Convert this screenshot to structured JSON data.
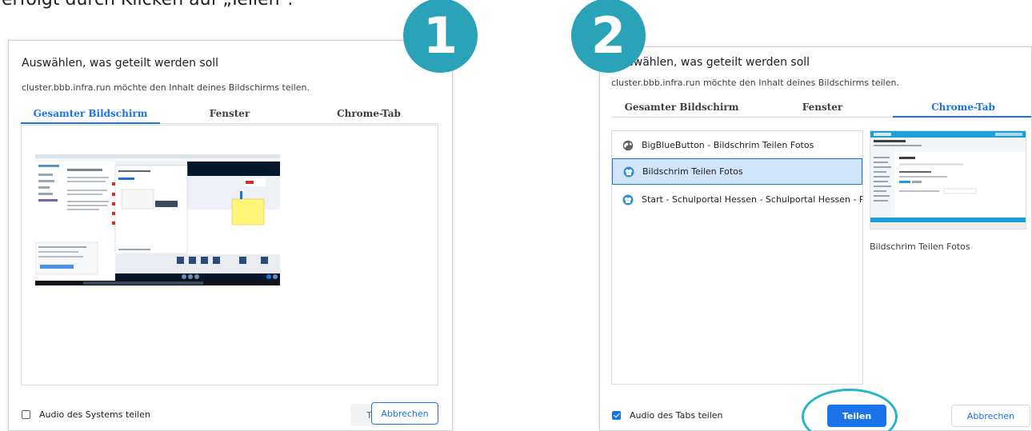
{
  "intro_text": "erfolgt durch Klicken auf „Teilen“.",
  "step1": {
    "badge": "1",
    "title": "Auswählen, was geteilt werden soll",
    "subtitle": "cluster.bbb.infra.run möchte den Inhalt deines Bildschirms teilen.",
    "tabs": [
      "Gesamter Bildschirm",
      "Fenster",
      "Chrome-Tab"
    ],
    "active_tab": 0,
    "audio_label": "Audio des Systems teilen",
    "audio_checked": false,
    "share_button": "Teilen",
    "cancel_button": "Abbrechen"
  },
  "step2": {
    "badge": "2",
    "title": "Auswählen, was geteilt werden soll",
    "subtitle": "cluster.bbb.infra.run möchte den Inhalt deines Bildschirms teilen.",
    "tabs": [
      "Gesamter Bildschirm",
      "Fenster",
      "Chrome-Tab"
    ],
    "active_tab": 2,
    "list": [
      {
        "label": "BigBlueButton - Bildschrim Teilen Fotos",
        "icon": "globe-icon",
        "selected": false
      },
      {
        "label": "Bildschrim Teilen Fotos",
        "icon": "bbb-favicon-icon",
        "selected": true
      },
      {
        "label": "Start - Schulportal Hessen - Schulportal Hessen - Päd...",
        "icon": "bbb-favicon-icon",
        "selected": false
      }
    ],
    "preview": {
      "caption": "Bildschrim Teilen Fotos"
    },
    "audio_label": "Audio des Tabs teilen",
    "audio_checked": true,
    "share_button": "Teilen",
    "cancel_button": "Abbrechen"
  },
  "colors": {
    "accent": "#1a73e8",
    "badge": "#2aa3b8",
    "highlight_ring": "#2ab5c4",
    "selected_bg": "#d2e3fc"
  }
}
